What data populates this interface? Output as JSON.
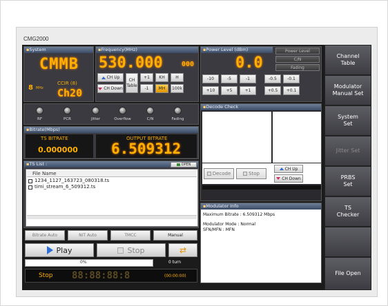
{
  "app": {
    "title": "CMG2000"
  },
  "system": {
    "header": "System",
    "mode": "CMMB",
    "bandwidth_value": "8",
    "bandwidth_unit": "MHz",
    "standard": "CCIR (8)",
    "channel": "Ch20"
  },
  "frequency": {
    "header": "Frequency(MHz)",
    "value": "530.000",
    "sub_digits": "000",
    "ch_up": "CH Up",
    "ch_down": "CH Down",
    "ch_table": "CH\nTable",
    "steps": [
      "+1",
      "KH",
      "H",
      "-1",
      "MH",
      "100k"
    ],
    "step_active": "MH"
  },
  "power": {
    "header": "Power Level (dBm)",
    "value": "0.0",
    "tabs": [
      "Power Level",
      "C/N",
      "Fading"
    ],
    "steps_top": [
      "-10",
      "-5",
      "-1",
      "-0.5",
      "-0.1"
    ],
    "steps_bottom": [
      "+10",
      "+5",
      "+1",
      "+0.5",
      "+0.1"
    ]
  },
  "status": {
    "lamps": [
      "RF",
      "PCR",
      "Jitter",
      "Overflow",
      "C/N",
      "Fading"
    ]
  },
  "bitrate": {
    "header": "Bitrate(Mbps)",
    "ts_label": "TS BITRATE",
    "ts_value": "0.000000",
    "output_label": "OUTPUT BITRATE",
    "output_value": "6.509312"
  },
  "decode": {
    "header": "Decode Check",
    "decode_btn": "Decode",
    "stop_btn": "Stop",
    "ch_up": "CH Up",
    "ch_down": "CH Down"
  },
  "ts_list": {
    "header": "TS List :",
    "open_btn": "OPEN",
    "column": "File Name",
    "files": [
      "1234_1127_163723_080318.ts",
      "timi_stream_6_509312.ts"
    ]
  },
  "modes": {
    "buttons": [
      "Bitrate Auto",
      "NIT Auto",
      "TMCC",
      "Manual"
    ]
  },
  "transport": {
    "play": "Play",
    "stop": "Stop",
    "progress_pct": "0%",
    "progress_value": 0,
    "turns": "0 turn",
    "state": "Stop",
    "time_digits": "88:88:88:8",
    "time_text": "(00:00:00)"
  },
  "modulator": {
    "header": "Modulator Info",
    "max_bitrate": "Maximum Bitrate : 6.509312 Mbps",
    "mode": "Modulator Mode : Normal",
    "sfn": "SFN/MFN : MFN"
  },
  "sidebar": {
    "items": [
      "Channel\nTable",
      "Modulator\nManual Set",
      "System\nSet",
      "Jitter Set",
      "PRBS\nSet",
      "TS\nChecker",
      "",
      "File Open"
    ]
  },
  "colors": {
    "segment": "#ffb000",
    "header": "#4e6080",
    "app_bg": "#1b1b1b",
    "active_step": "#ffb000"
  }
}
